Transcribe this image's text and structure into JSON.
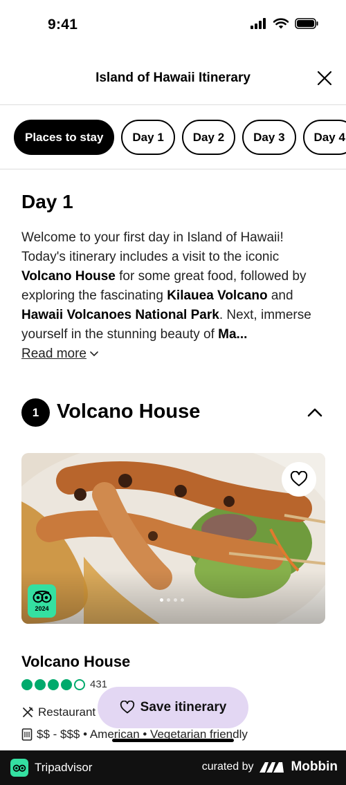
{
  "status_bar": {
    "time": "9:41"
  },
  "header": {
    "title": "Island of Hawaii Itinerary"
  },
  "tabs": [
    {
      "label": "Places to stay",
      "active": true
    },
    {
      "label": "Day 1",
      "active": false
    },
    {
      "label": "Day 2",
      "active": false
    },
    {
      "label": "Day 3",
      "active": false
    },
    {
      "label": "Day 4",
      "active": false
    }
  ],
  "day": {
    "title": "Day 1",
    "intro": [
      {
        "text": "Welcome to your first day in Island of Hawaii! Today's itinerary includes a visit to the iconic ",
        "bold": false
      },
      {
        "text": "Volcano House",
        "bold": true
      },
      {
        "text": " for some great food, followed by exploring the fascinating ",
        "bold": false
      },
      {
        "text": "Kilauea Volcano",
        "bold": true
      },
      {
        "text": " and ",
        "bold": false
      },
      {
        "text": "Hawaii Volcanoes National Park",
        "bold": true
      },
      {
        "text": ". Next, immerse yourself in the stunning beauty of ",
        "bold": false
      },
      {
        "text": "Ma...",
        "bold": true
      }
    ],
    "read_more": "Read more"
  },
  "place": {
    "number": "1",
    "title": "Volcano House",
    "name": "Volcano House",
    "rating_bubbles": 4.5,
    "review_count": "431",
    "category": "Restaurant",
    "details": "$$ - $$$ • American • Vegetarian friendly",
    "badge_year": "2024",
    "photo_count": 4,
    "photo_index": 1
  },
  "save_button": {
    "label": "Save itinerary"
  },
  "brand_bar": {
    "left": "Tripadvisor",
    "curated": "curated by",
    "right": "Mobbin"
  },
  "colors": {
    "accent_green": "#00aa6c",
    "badge_green": "#34e0a1",
    "save_bg": "#e3d7f3"
  }
}
